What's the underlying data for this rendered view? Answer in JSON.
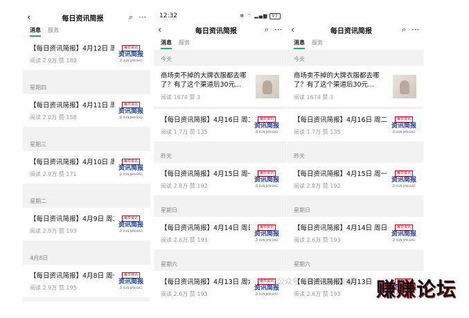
{
  "account": {
    "name": "每日资讯简报"
  },
  "tabs": [
    "消息",
    "服务"
  ],
  "logo": {
    "top": "每日资讯",
    "main": "资讯简报",
    "bottom": "ZI XUN JIAN BAO"
  },
  "status": {
    "time": "12:32",
    "icons": "✻ ⌔ ▂▄▆",
    "battery": "97"
  },
  "panel1": {
    "items": [
      {
        "label": "",
        "title": "【每日资讯简报】4月12日 周五",
        "reads": "阅读 2.9万",
        "likes": "赞 189"
      },
      {
        "label": "星期四",
        "title": "【每日资讯简报】4月11日 周四",
        "reads": "阅读 2.0万",
        "likes": "赞 158"
      },
      {
        "label": "星期三",
        "title": "【每日资讯简报】4月10日 周三",
        "reads": "阅读 2.9万",
        "likes": "赞 171"
      },
      {
        "label": "星期二",
        "title": "【每日资讯简报】4月9日 周二",
        "reads": "阅读 2.9万",
        "likes": "赞 193"
      },
      {
        "label": "4月8日",
        "title": "【每日资讯简报】4月8日 周一",
        "reads": "阅读 2.9万",
        "likes": "赞 195"
      }
    ]
  },
  "panel2": {
    "today_label": "今天",
    "ad": {
      "title": "商场卖不掉的大牌衣服都去哪了？有了这个渠道后30元...",
      "reads": "阅读 1674",
      "likes": "赞 3"
    },
    "items": [
      {
        "label": "",
        "title": "【每日资讯简报】4月16日 周二",
        "reads": "阅读 1.7万",
        "likes": "赞 135"
      },
      {
        "label": "昨天",
        "title": "【每日资讯简报】4月15日 周一",
        "reads": "阅读 2.8万",
        "likes": "赞 192"
      },
      {
        "label": "星期日",
        "title": "【每日资讯简报】4月14日 周日",
        "reads": "阅读 2.6万",
        "likes": "赞 193"
      },
      {
        "label": "星期六",
        "title": "【每日资讯简报】4月13日 周六",
        "reads": "阅读 2.6万",
        "likes": "赞 193"
      }
    ]
  },
  "panel3": {
    "today_label": "今天",
    "ad": {
      "title": "商场卖不掉的大牌衣服都去哪了？有了这个渠道后30元...",
      "reads": "阅读 1674",
      "likes": "赞 3"
    },
    "items": [
      {
        "label": "",
        "title": "【每日资讯简报】4月16日 周二",
        "reads": "阅读 1.7万",
        "likes": "赞 135"
      },
      {
        "label": "昨天",
        "title": "【每日资讯简报】4月15日 周一",
        "reads": "阅读 2.8万",
        "likes": "赞 192"
      },
      {
        "label": "星期日",
        "title": "【每日资讯简报】4月14日 周日",
        "reads": "阅读 2.6万",
        "likes": "赞 193"
      },
      {
        "label": "星期六",
        "title": "【每日资讯简报】4月13日",
        "reads": "阅读 2.6万",
        "likes": "赞 193"
      }
    ]
  },
  "watermark": {
    "faint": "公众号 · 每日资讯简报",
    "main": "赚赚论坛"
  }
}
